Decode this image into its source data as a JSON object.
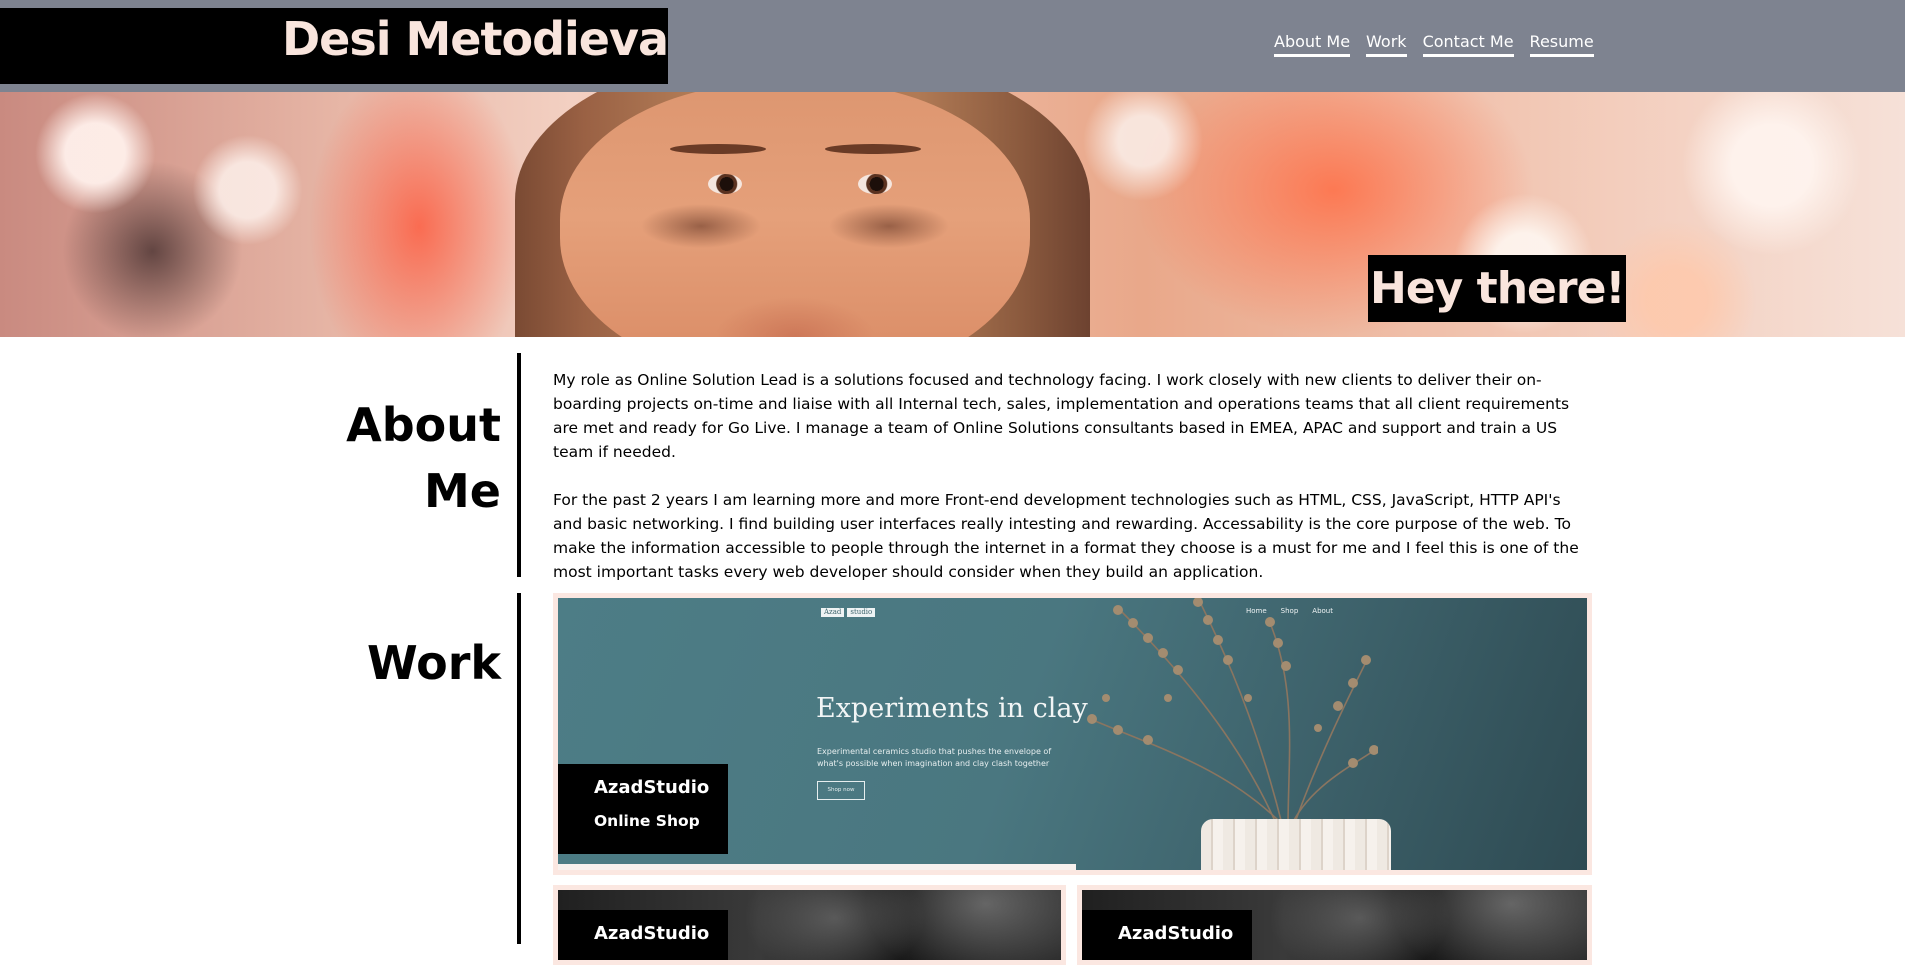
{
  "header": {
    "site_name": "Desi Metodieva",
    "nav": {
      "about": "About Me",
      "work": "Work",
      "contact": "Contact Me",
      "resume": "Resume"
    }
  },
  "hero": {
    "greeting": "Hey there!"
  },
  "about": {
    "title_line1": "About",
    "title_line2": "Me",
    "paragraph1": "My role as Online Solution Lead is a solutions focused and technology facing. I work closely with new clients to deliver their on-boarding projects on-time and liaise with all Internal tech, sales, implementation and operations teams that all client requirements are met and ready for Go Live. I manage a team of Online Solutions consultants based in EMEA, APAC and support and train a US team if needed.",
    "paragraph2": "For the past 2 years I am learning more and more Front-end development technologies such as HTML, CSS, JavaScript, HTTP API's and basic networking. I find building user interfaces really intesting and rewarding. Accessability is the core purpose of the web. To make the information accessible to people through the internet in a format they choose is a must for me and I feel this is one of the most important tasks every web developer should consider when they build an application."
  },
  "work": {
    "title": "Work",
    "projects": [
      {
        "name": "AzadStudio",
        "type": "Online Shop",
        "preview": {
          "logo": "Azad",
          "logo_badge": "studio",
          "nav": [
            "Home",
            "Shop",
            "About"
          ],
          "heading": "Experiments in clay",
          "subtext": "Experimental ceramics studio that pushes the envelope of what's possible when imagination and clay clash together",
          "button": "Shop now"
        }
      },
      {
        "name": "AzadStudio"
      },
      {
        "name": "AzadStudio"
      }
    ]
  },
  "colors": {
    "header_bg": "#7e8390",
    "brand_text": "#f9e5dd",
    "card_border": "#fbe7e1",
    "accent_black": "#000000"
  }
}
